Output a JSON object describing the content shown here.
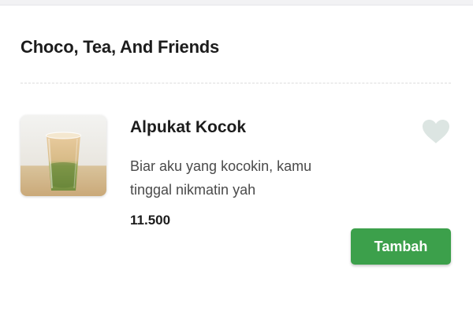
{
  "section": {
    "title": "Choco, Tea, And Friends"
  },
  "item": {
    "name": "Alpukat Kocok",
    "description_lines": [
      "Biar aku yang kocokin, kamu",
      "tinggal nikmatin yah"
    ],
    "price": "11.500",
    "image_icon": "avocado-shake-drink-photo",
    "favorite_icon": "heart-icon",
    "favorited": false,
    "add_button_label": "Tambah"
  },
  "colors": {
    "accent": "#3ca04b",
    "heart_inactive": "#dce5e2",
    "title_text": "#1c1c1c",
    "desc_text": "#4a4a4a"
  }
}
